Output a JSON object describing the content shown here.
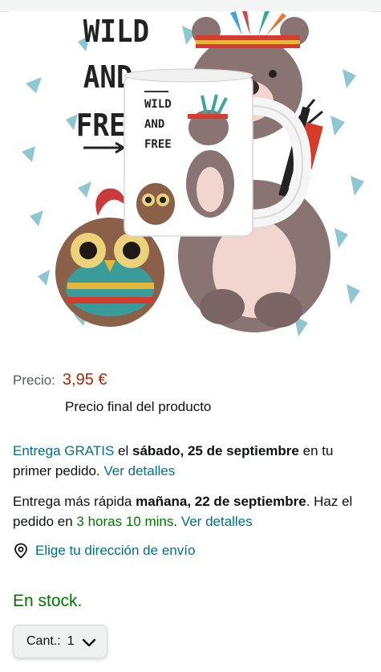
{
  "product_image": {
    "alt_text_visible": [
      "WILD",
      "AND",
      "FRE",
      "WILD",
      "AND",
      "FREE"
    ]
  },
  "price": {
    "label": "Precio:",
    "value": "3,95 €",
    "note": "Precio final del producto"
  },
  "delivery": {
    "link_text": "Entrega GRATIS",
    "text_el": "el",
    "date": "sábado, 25 de septiembre",
    "text_rest": "en tu primer pedido.",
    "details_link": "Ver detalles"
  },
  "fast_delivery": {
    "text_intro": "Entrega más rápida",
    "date": "mañana, 22 de septiembre",
    "text_mid": ". Haz el pedido en",
    "countdown": "3 horas 10 mins",
    "details_link": "Ver detalles"
  },
  "address": {
    "label": "Elige tu dirección de envío",
    "icon": "location-pin-icon"
  },
  "stock": {
    "label": "En stock."
  },
  "quantity": {
    "label": "Cant.:",
    "value": "1"
  },
  "colors": {
    "price": "#b12704",
    "link": "#007185",
    "in_stock": "#007600"
  }
}
